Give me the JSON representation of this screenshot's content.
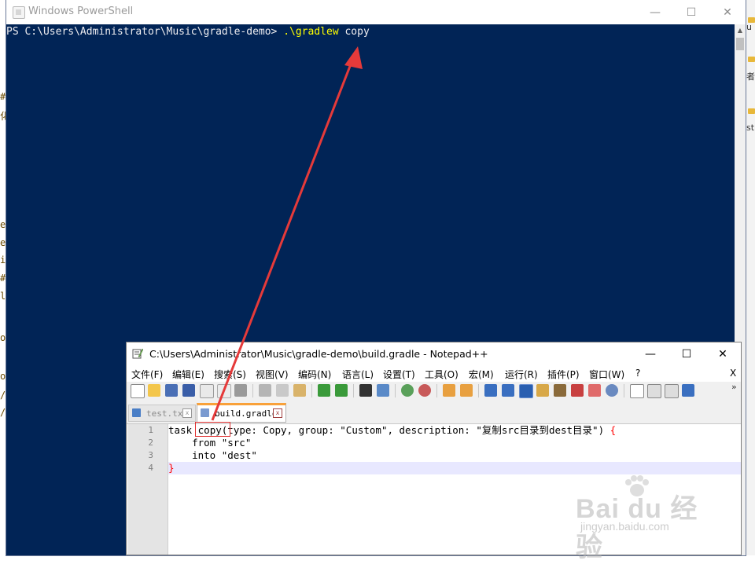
{
  "background": {
    "left_fragments": [
      "#",
      "化",
      "e",
      "e",
      "i",
      "#",
      "l",
      "oy",
      "o",
      "/",
      "/"
    ],
    "right_fragments": [
      "u",
      "者",
      "st"
    ]
  },
  "powershell": {
    "title": "Windows PowerShell",
    "prompt": "PS C:\\Users\\Administrator\\Music\\gradle-demo> ",
    "command": ".\\gradlew",
    "argument": " copy",
    "minimize_glyph": "—",
    "maximize_glyph": "☐",
    "close_glyph": "✕"
  },
  "notepadpp": {
    "title": "C:\\Users\\Administrator\\Music\\gradle-demo\\build.gradle - Notepad++",
    "minimize_glyph": "—",
    "maximize_glyph": "☐",
    "close_glyph": "✕",
    "menu": [
      "文件(F)",
      "编辑(E)",
      "搜索(S)",
      "视图(V)",
      "编码(N)",
      "语言(L)",
      "设置(T)",
      "工具(O)",
      "宏(M)",
      "运行(R)",
      "插件(P)",
      "窗口(W)",
      "?"
    ],
    "menu_close": "X",
    "toolbar_more": "»",
    "tabs": [
      {
        "label": "test.txt",
        "close": "x"
      },
      {
        "label": "build.gradle",
        "close": "x"
      }
    ],
    "line_numbers": [
      "1",
      "2",
      "3",
      "4"
    ],
    "code": {
      "line1": {
        "pre": "task ",
        "name": "copy",
        "rest": "(type: Copy, group: \"Custom\", description: \"复制src目录到dest目录\") ",
        "brace": "{"
      },
      "line2": "    from \"src\"",
      "line3": "    into \"dest\"",
      "line4_brace": "}"
    }
  },
  "watermark": {
    "logo": "Bai  du 经验",
    "url": "jingyan.baidu.com"
  },
  "colors": {
    "ps_background": "#012456",
    "ps_command": "#ffff00",
    "annotation_red": "#e03030",
    "npp_tab_accent": "#f9a13a"
  }
}
